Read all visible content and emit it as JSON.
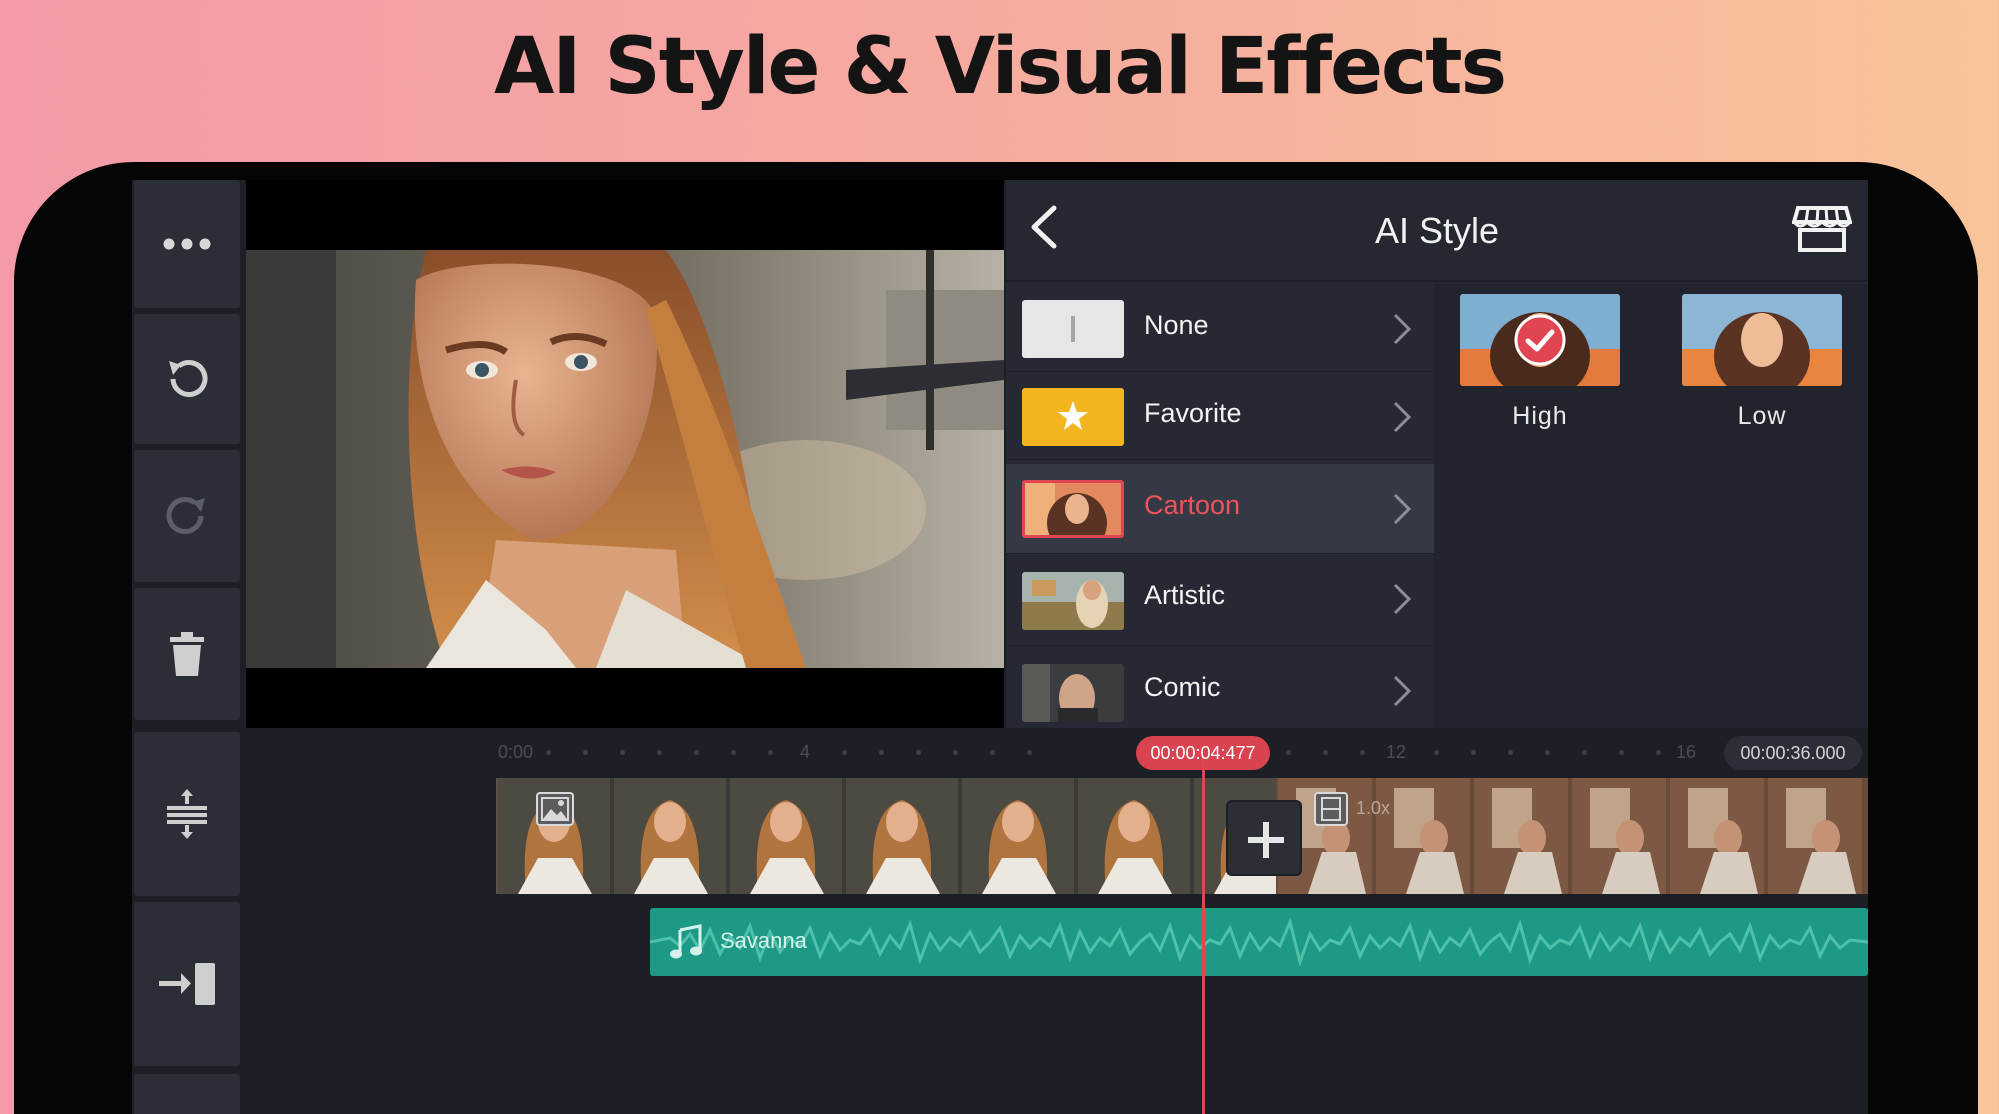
{
  "headline": "AI Style & Visual Effects",
  "toolbar": {
    "items": [
      "more-icon",
      "undo-icon",
      "redo-icon",
      "delete-icon",
      "split-layers-icon",
      "import-icon"
    ]
  },
  "panel": {
    "title": "AI Style",
    "styles": [
      {
        "label": "None",
        "selected": false
      },
      {
        "label": "Favorite",
        "selected": false
      },
      {
        "label": "Cartoon",
        "selected": true
      },
      {
        "label": "Artistic",
        "selected": false
      },
      {
        "label": "Comic",
        "selected": false
      }
    ],
    "strengths": [
      {
        "label": "High",
        "selected": true
      },
      {
        "label": "Low",
        "selected": false
      }
    ]
  },
  "timeline": {
    "ruler_marks": [
      "0:00",
      "4",
      "12",
      "16"
    ],
    "current_time": "00:00:04:477",
    "total_time": "00:00:36.000",
    "clip_speed": "1.0x",
    "audio_track_name": "Savanna"
  },
  "colors": {
    "accent": "#e04552",
    "panel_bg": "#262833",
    "audio_track": "#1c9a85",
    "favorite_tile": "#f2b51f"
  }
}
